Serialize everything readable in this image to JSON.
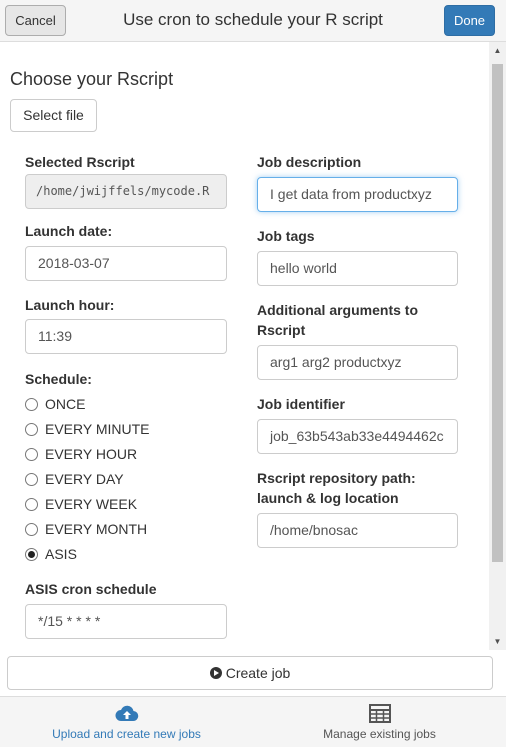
{
  "header": {
    "cancel_label": "Cancel",
    "title": "Use cron to schedule your R script",
    "done_label": "Done"
  },
  "choose": {
    "title": "Choose your Rscript",
    "select_file_label": "Select file"
  },
  "left": {
    "selected_rscript_label": "Selected Rscript",
    "selected_rscript_value": "/home/jwijffels/mycode.R",
    "launch_date_label": "Launch date:",
    "launch_date_value": "2018-03-07",
    "launch_hour_label": "Launch hour:",
    "launch_hour_value": "11:39",
    "schedule_label": "Schedule:",
    "schedule_options": [
      "ONCE",
      "EVERY MINUTE",
      "EVERY HOUR",
      "EVERY DAY",
      "EVERY WEEK",
      "EVERY MONTH",
      "ASIS"
    ],
    "schedule_selected": "ASIS",
    "asis_label": "ASIS cron schedule",
    "asis_value": "*/15 * * * *"
  },
  "right": {
    "job_description_label": "Job description",
    "job_description_value": "I get data from productxyz",
    "job_tags_label": "Job tags",
    "job_tags_value": "hello world",
    "additional_args_label_1": "Additional arguments to",
    "additional_args_label_2": "Rscript",
    "additional_args_value": "arg1 arg2 productxyz",
    "job_identifier_label": "Job identifier",
    "job_identifier_value": "job_63b543ab33e4494462c",
    "repo_path_label_1": "Rscript repository path:",
    "repo_path_label_2": "launch & log location",
    "repo_path_value": "/home/bnosac"
  },
  "create_job_label": "Create job",
  "tabs": [
    {
      "label": "Upload and create new jobs",
      "icon": "cloud-upload-icon",
      "active": true
    },
    {
      "label": "Manage existing jobs",
      "icon": "table-icon",
      "active": false
    }
  ],
  "colors": {
    "primary": "#337ab7",
    "active_tab": "#337ab7",
    "inactive_tab": "#555555",
    "focus_border": "#66afe9"
  }
}
